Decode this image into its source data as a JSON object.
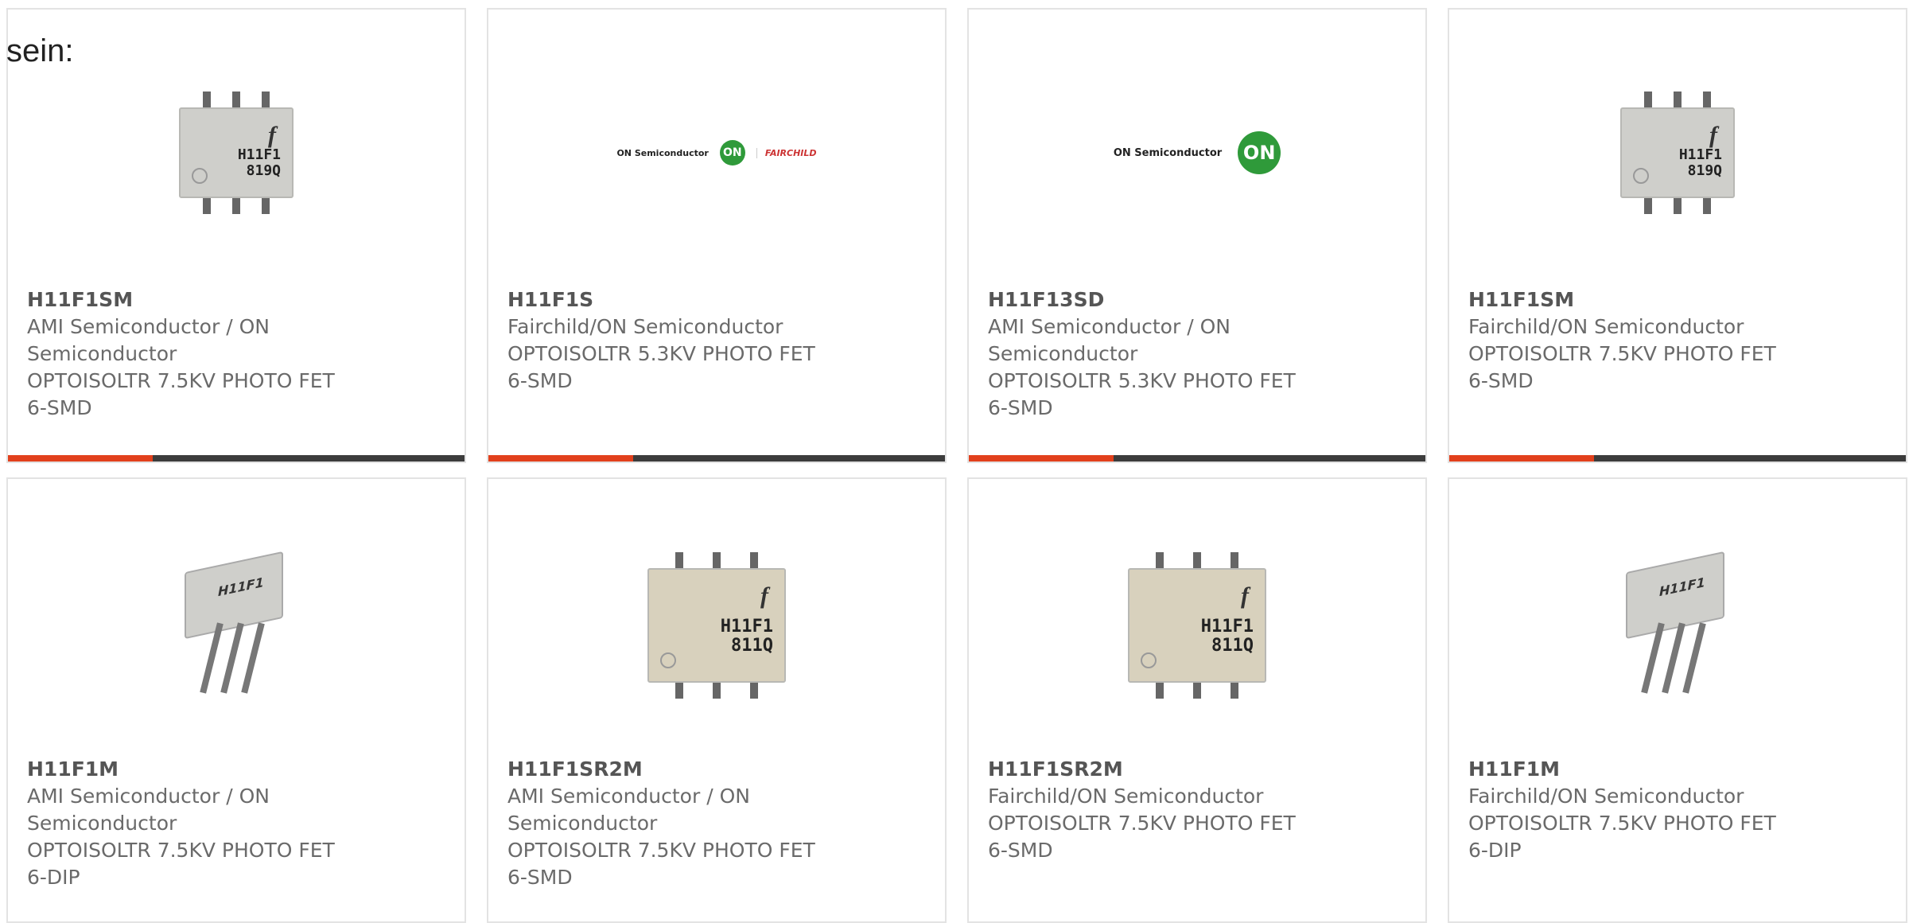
{
  "intro_text": "sein:",
  "colors": {
    "accent": "#e2401c",
    "bar": "#3c3c3c"
  },
  "products": [
    {
      "part": "H11F1SM",
      "maker_lines": [
        "AMI Semiconductor / ON",
        "Semiconductor"
      ],
      "desc": "OPTOISOLTR 7.5KV PHOTO FET",
      "package": "6-SMD",
      "image": "smd-chip-819q",
      "chip_mark": [
        "H11F1",
        "819Q"
      ]
    },
    {
      "part": "H11F1S",
      "maker_lines": [
        "Fairchild/ON Semiconductor"
      ],
      "desc": "OPTOISOLTR 5.3KV PHOTO FET",
      "package": "6-SMD",
      "image": "on-fairchild-logo",
      "brand_text": "ON Semiconductor",
      "brand_extra": "FAIRCHILD"
    },
    {
      "part": "H11F13SD",
      "maker_lines": [
        "AMI Semiconductor / ON",
        "Semiconductor"
      ],
      "desc": "OPTOISOLTR 5.3KV PHOTO FET",
      "package": "6-SMD",
      "image": "on-logo",
      "brand_text": "ON Semiconductor"
    },
    {
      "part": "H11F1SM",
      "maker_lines": [
        "Fairchild/ON Semiconductor"
      ],
      "desc": "OPTOISOLTR 7.5KV PHOTO FET",
      "package": "6-SMD",
      "image": "smd-chip-819q",
      "chip_mark": [
        "H11F1",
        "819Q"
      ]
    },
    {
      "part": "H11F1M",
      "maker_lines": [
        "AMI Semiconductor / ON",
        "Semiconductor"
      ],
      "desc": "OPTOISOLTR 7.5KV PHOTO FET",
      "package": "6-DIP",
      "image": "dip-chip",
      "chip_mark": [
        "H11F1"
      ]
    },
    {
      "part": "H11F1SR2M",
      "maker_lines": [
        "AMI Semiconductor / ON",
        "Semiconductor"
      ],
      "desc": "OPTOISOLTR 7.5KV PHOTO FET",
      "package": "6-SMD",
      "image": "smd-chip-811q",
      "chip_mark": [
        "H11F1",
        "811Q"
      ]
    },
    {
      "part": "H11F1SR2M",
      "maker_lines": [
        "Fairchild/ON Semiconductor"
      ],
      "desc": "OPTOISOLTR 7.5KV PHOTO FET",
      "package": "6-SMD",
      "image": "smd-chip-811q",
      "chip_mark": [
        "H11F1",
        "811Q"
      ]
    },
    {
      "part": "H11F1M",
      "maker_lines": [
        "Fairchild/ON Semiconductor"
      ],
      "desc": "OPTOISOLTR 7.5KV PHOTO FET",
      "package": "6-DIP",
      "image": "dip-chip",
      "chip_mark": [
        "H11F1"
      ]
    }
  ]
}
